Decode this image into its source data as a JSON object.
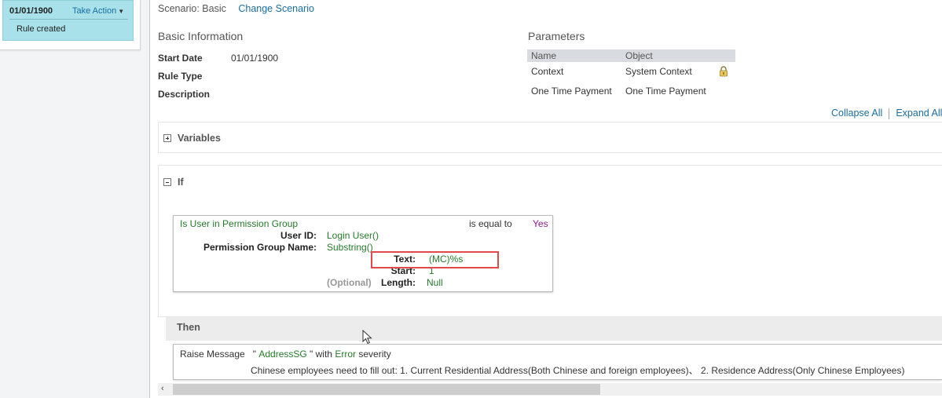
{
  "history": {
    "date": "01/01/1900",
    "take_action_label": "Take Action",
    "note": "Rule created"
  },
  "scenario": {
    "label": "Scenario: Basic",
    "change_link": "Change Scenario"
  },
  "basic_info": {
    "title": "Basic Information",
    "fields": [
      {
        "label": "Start Date",
        "value": "01/01/1900"
      },
      {
        "label": "Rule Type",
        "value": ""
      },
      {
        "label": "Description",
        "value": ""
      }
    ]
  },
  "parameters": {
    "title": "Parameters",
    "columns": [
      "Name",
      "Object"
    ],
    "rows": [
      {
        "name": "Context",
        "object": "System Context",
        "locked": true
      },
      {
        "name": "One Time Payment",
        "object": "One Time Payment",
        "locked": false
      }
    ]
  },
  "toolbar": {
    "collapse_all": "Collapse All",
    "expand_all": "Expand All"
  },
  "variables_title": "Variables",
  "if_title": "If",
  "condition": {
    "function": "Is User in Permission Group",
    "operator": "is equal to",
    "value": "Yes",
    "user_id_label": "User ID:",
    "user_id_value": "Login User()",
    "perm_group_label": "Permission Group Name:",
    "perm_group_value": "Substring()",
    "text_label": "Text:",
    "text_value": "(MC)%s",
    "start_label": "Start:",
    "start_value": "1",
    "optional_label": "(Optional)",
    "length_label": "Length:",
    "length_value": "Null"
  },
  "then_title": "Then",
  "message": {
    "prefix": "Raise Message",
    "quote_open": "\"",
    "name": "AddressSG",
    "quote_close": "\" with",
    "level": "Error",
    "suffix": "severity",
    "text": "Chinese employees need to fill out: 1. Current Residential Address(Both Chinese and foreign employees)、 2. Residence Address(Only Chinese Employees)"
  },
  "colors": {
    "link": "#1a6ea0",
    "green": "#267a2b",
    "purple": "#8a1a8a",
    "highlight": "#e24a4a",
    "history_bg": "#a8e1ea"
  }
}
